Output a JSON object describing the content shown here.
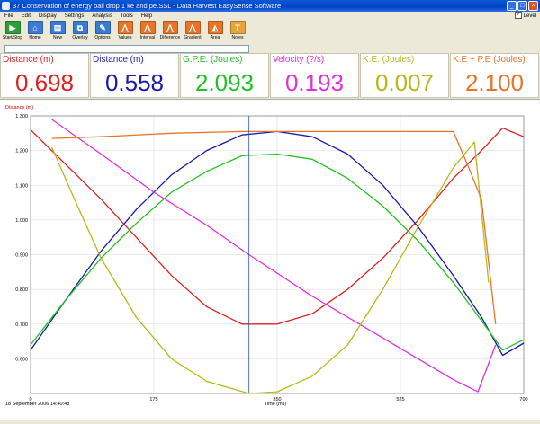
{
  "window": {
    "title": "37 Conservation of  energy ball drop 1 ke and pe.SSL - Data Harvest EasySense Software"
  },
  "menu": [
    "File",
    "Edit",
    "Display",
    "Settings",
    "Analysis",
    "Tools",
    "Help"
  ],
  "level_label": "Level",
  "toolbar": [
    {
      "label": "Start/Stop",
      "icon": "play-icon",
      "color": "#2e9e3a"
    },
    {
      "label": "Home",
      "icon": "home-icon",
      "color": "#3a7bd5"
    },
    {
      "label": "New",
      "icon": "new-icon",
      "color": "#3a7bd5"
    },
    {
      "label": "Overlay",
      "icon": "overlay-icon",
      "color": "#3a7bd5"
    },
    {
      "label": "Options",
      "icon": "options-icon",
      "color": "#3a7bd5"
    },
    {
      "label": "Values",
      "icon": "values-icon",
      "color": "#e8742a"
    },
    {
      "label": "Interval",
      "icon": "interval-icon",
      "color": "#e8742a"
    },
    {
      "label": "Difference",
      "icon": "difference-icon",
      "color": "#e8742a"
    },
    {
      "label": "Gradient",
      "icon": "gradient-icon",
      "color": "#e8742a"
    },
    {
      "label": "Area",
      "icon": "area-icon",
      "color": "#e8742a"
    },
    {
      "label": "Notes",
      "icon": "notes-icon",
      "color": "#e8a33a"
    }
  ],
  "readouts": [
    {
      "label": "Distance (m)",
      "value": "0.698",
      "color": "#dd2020"
    },
    {
      "label": "Distance (m)",
      "value": "0.558",
      "color": "#1a1aa8"
    },
    {
      "label": "G.P.E. (Joules)",
      "value": "2.093",
      "color": "#22c222"
    },
    {
      "label": "Velocity (?/s)",
      "value": "0.193",
      "color": "#e030e0"
    },
    {
      "label": "K.E. (Joules)",
      "value": "0.007",
      "color": "#b8b818"
    },
    {
      "label": "K.E + P.E (Joules)",
      "value": "2.100",
      "color": "#e8742a"
    }
  ],
  "chart_data": {
    "type": "line",
    "ylabel": "Distance (m)",
    "xlabel": "Time (ms)",
    "date_label": "18 September 2006  14:40:48",
    "xlim": [
      0,
      700
    ],
    "ylim": [
      0.5,
      1.3
    ],
    "x_ticks": [
      0,
      175,
      350,
      525,
      700
    ],
    "y_ticks": [
      0.6,
      0.7,
      0.8,
      0.9,
      1.0,
      1.1,
      1.2,
      1.3
    ],
    "y_tick_labels": [
      "0.600",
      "0.700",
      "0.800",
      "0.900",
      "1.000",
      "1.100",
      "1.200",
      "1.300"
    ],
    "cursor_x": 310,
    "series": [
      {
        "color": "#dd2020",
        "points": [
          [
            0,
            1.26
          ],
          [
            50,
            1.16
          ],
          [
            100,
            1.06
          ],
          [
            150,
            0.95
          ],
          [
            200,
            0.84
          ],
          [
            250,
            0.75
          ],
          [
            300,
            0.7
          ],
          [
            350,
            0.7
          ],
          [
            400,
            0.73
          ],
          [
            450,
            0.8
          ],
          [
            500,
            0.89
          ],
          [
            550,
            1.0
          ],
          [
            600,
            1.12
          ],
          [
            640,
            1.2
          ],
          [
            670,
            1.265
          ],
          [
            700,
            1.24
          ]
        ]
      },
      {
        "color": "#1a1aa8",
        "points": [
          [
            0,
            0.625
          ],
          [
            50,
            0.77
          ],
          [
            100,
            0.91
          ],
          [
            150,
            1.03
          ],
          [
            200,
            1.13
          ],
          [
            250,
            1.2
          ],
          [
            300,
            1.245
          ],
          [
            350,
            1.255
          ],
          [
            400,
            1.24
          ],
          [
            450,
            1.19
          ],
          [
            500,
            1.1
          ],
          [
            550,
            0.98
          ],
          [
            600,
            0.84
          ],
          [
            640,
            0.72
          ],
          [
            670,
            0.61
          ],
          [
            700,
            0.645
          ]
        ]
      },
      {
        "color": "#22c222",
        "points": [
          [
            0,
            0.64
          ],
          [
            50,
            0.77
          ],
          [
            100,
            0.89
          ],
          [
            150,
            0.99
          ],
          [
            200,
            1.08
          ],
          [
            250,
            1.14
          ],
          [
            300,
            1.185
          ],
          [
            350,
            1.19
          ],
          [
            400,
            1.175
          ],
          [
            450,
            1.12
          ],
          [
            500,
            1.04
          ],
          [
            550,
            0.94
          ],
          [
            600,
            0.82
          ],
          [
            640,
            0.71
          ],
          [
            670,
            0.625
          ],
          [
            700,
            0.655
          ]
        ]
      },
      {
        "color": "#e030e0",
        "points": [
          [
            30,
            1.29
          ],
          [
            100,
            1.19
          ],
          [
            175,
            1.08
          ],
          [
            250,
            0.985
          ],
          [
            310,
            0.9
          ],
          [
            400,
            0.78
          ],
          [
            500,
            0.66
          ],
          [
            600,
            0.54
          ],
          [
            635,
            0.505
          ],
          [
            660,
            0.64
          ]
        ]
      },
      {
        "color": "#b8b818",
        "points": [
          [
            30,
            1.21
          ],
          [
            60,
            1.07
          ],
          [
            100,
            0.89
          ],
          [
            150,
            0.72
          ],
          [
            200,
            0.6
          ],
          [
            250,
            0.535
          ],
          [
            310,
            0.5
          ],
          [
            350,
            0.505
          ],
          [
            400,
            0.55
          ],
          [
            450,
            0.64
          ],
          [
            500,
            0.8
          ],
          [
            550,
            0.98
          ],
          [
            600,
            1.15
          ],
          [
            630,
            1.225
          ],
          [
            650,
            0.82
          ]
        ]
      },
      {
        "color": "#e8742a",
        "points": [
          [
            30,
            1.235
          ],
          [
            100,
            1.24
          ],
          [
            200,
            1.25
          ],
          [
            300,
            1.255
          ],
          [
            400,
            1.255
          ],
          [
            500,
            1.255
          ],
          [
            560,
            1.255
          ],
          [
            600,
            1.255
          ],
          [
            620,
            1.16
          ],
          [
            640,
            1.06
          ],
          [
            660,
            0.7
          ]
        ]
      }
    ]
  }
}
